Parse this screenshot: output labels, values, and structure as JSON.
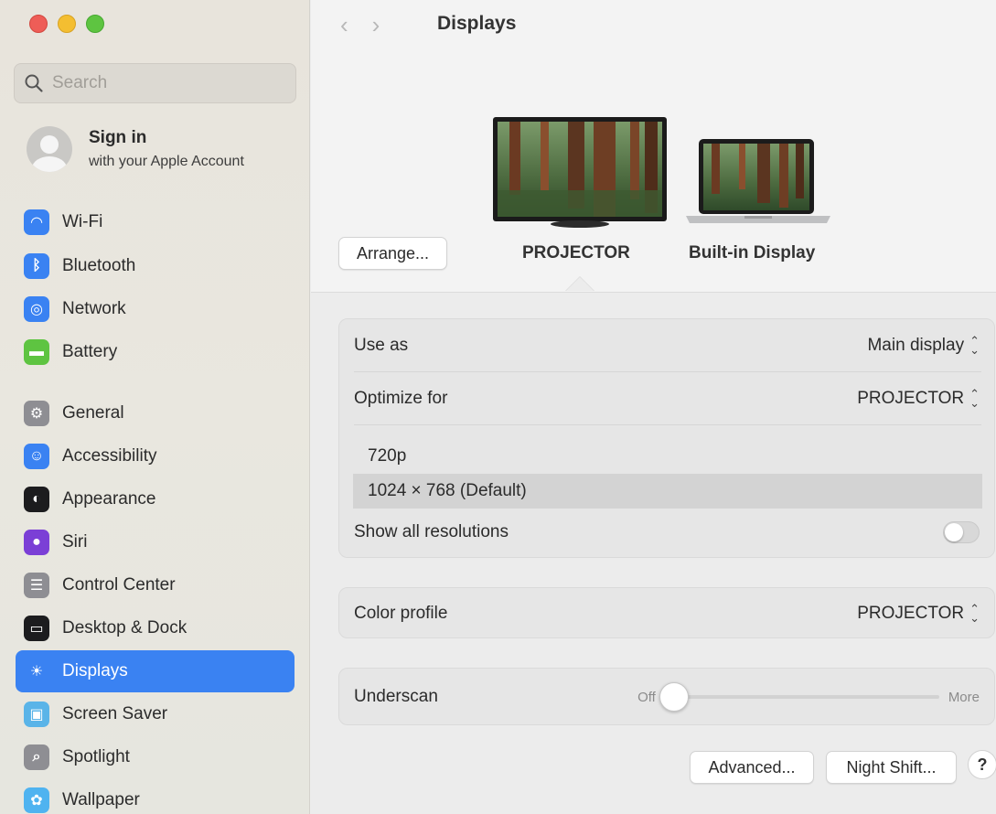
{
  "window": {
    "traffic_lights": [
      "close",
      "minimize",
      "zoom"
    ]
  },
  "sidebar": {
    "search_placeholder": "Search",
    "account": {
      "title": "Sign in",
      "subtitle": "with your Apple Account"
    },
    "items": [
      {
        "label": "Wi-Fi",
        "icon": "wifi-icon",
        "color": "#3a82f2"
      },
      {
        "label": "Bluetooth",
        "icon": "bluetooth-icon",
        "color": "#3a82f2"
      },
      {
        "label": "Network",
        "icon": "globe-icon",
        "color": "#3a82f2"
      },
      {
        "label": "Battery",
        "icon": "battery-icon",
        "color": "#5ec441"
      },
      {
        "label": "General",
        "icon": "gear-icon",
        "color": "#8e8e93"
      },
      {
        "label": "Accessibility",
        "icon": "accessibility-icon",
        "color": "#3a82f2"
      },
      {
        "label": "Appearance",
        "icon": "appearance-icon",
        "color": "#1c1c1e"
      },
      {
        "label": "Siri",
        "icon": "siri-icon",
        "color": "#7b3fd6"
      },
      {
        "label": "Control Center",
        "icon": "control-center-icon",
        "color": "#8e8e93"
      },
      {
        "label": "Desktop & Dock",
        "icon": "dock-icon",
        "color": "#1c1c1e"
      },
      {
        "label": "Displays",
        "icon": "brightness-icon",
        "color": "#3a82f2",
        "active": true
      },
      {
        "label": "Screen Saver",
        "icon": "screen-saver-icon",
        "color": "#5ab4e8"
      },
      {
        "label": "Spotlight",
        "icon": "magnifier-icon",
        "color": "#8e8e93"
      },
      {
        "label": "Wallpaper",
        "icon": "flower-icon",
        "color": "#4fb3f0"
      }
    ]
  },
  "header": {
    "title": "Displays",
    "back": "‹",
    "forward": "›"
  },
  "arrangement": {
    "arrange_label": "Arrange...",
    "displays": [
      {
        "name": "PROJECTOR",
        "selected": true
      },
      {
        "name": "Built-in Display",
        "selected": false
      }
    ]
  },
  "settings": {
    "use_as": {
      "label": "Use as",
      "value": "Main display"
    },
    "optimize_for": {
      "label": "Optimize for",
      "value": "PROJECTOR"
    },
    "resolutions": [
      {
        "label": "720p",
        "selected": false
      },
      {
        "label": "1024 × 768 (Default)",
        "selected": true
      }
    ],
    "show_all_resolutions": {
      "label": "Show all resolutions",
      "enabled": false
    },
    "color_profile": {
      "label": "Color profile",
      "value": "PROJECTOR"
    },
    "underscan": {
      "label": "Underscan",
      "min_label": "Off",
      "max_label": "More",
      "value": 0
    }
  },
  "footer": {
    "advanced_label": "Advanced...",
    "night_shift_label": "Night Shift...",
    "help_label": "?"
  }
}
